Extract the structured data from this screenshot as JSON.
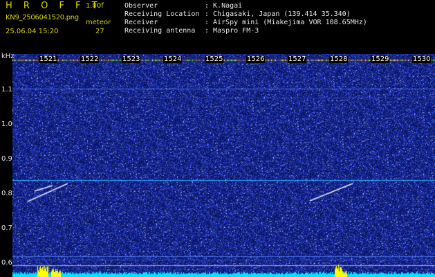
{
  "header": {
    "app_title": "H R O F F T",
    "version": "1.00f",
    "filename": "KN9_2506041520.png",
    "mode": "meteor",
    "datetime": "25.06.04 15:20",
    "count": "27",
    "info": [
      {
        "key": "Observer",
        "value": ": K.Nagai"
      },
      {
        "key": "Receiving Location",
        "value": ": Chigasaki, Japan (139.414 35.340)"
      },
      {
        "key": "Receiver",
        "value": ": AirSpy mini (Miakejima VOR 108.65MHz)"
      },
      {
        "key": "Receiving antenna",
        "value": ": Maspro FM-3"
      }
    ]
  },
  "y_axis": {
    "unit": "kHz",
    "labels": [
      "1.1",
      "1.0",
      "0.9",
      "0.8",
      "0.7",
      "0.6"
    ]
  },
  "x_axis": {
    "labels": [
      "1521",
      "1522",
      "1523",
      "1524",
      "1525",
      "1526",
      "1527",
      "1528",
      "1529",
      "1530"
    ]
  },
  "colors": {
    "label_yellow": "#d8d800",
    "noise_blue": "#1a2a9a",
    "carrier_cyan": "#30b0ff",
    "echo_white": "#e8e8ff",
    "signal_bar": "#00e5ff",
    "burst_yellow": "#ffff00"
  }
}
